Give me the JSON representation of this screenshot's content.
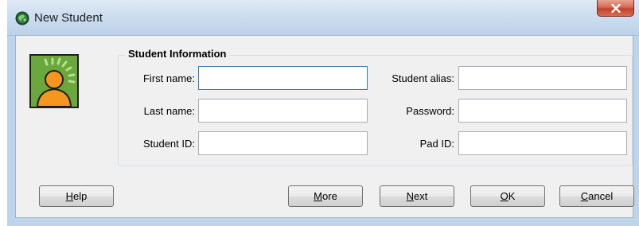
{
  "window": {
    "title": "New Student",
    "icon": "app-globe-icon",
    "close_icon": "close-x-icon"
  },
  "avatar": {
    "icon": "student-avatar-icon"
  },
  "student_info": {
    "group_title": "Student Information",
    "first_name": {
      "label": "First name:",
      "value": ""
    },
    "last_name": {
      "label": "Last name:",
      "value": ""
    },
    "student_id": {
      "label": "Student ID:",
      "value": ""
    },
    "student_alias": {
      "label": "Student alias:",
      "value": ""
    },
    "password": {
      "label": "Password:",
      "value": ""
    },
    "pad_id": {
      "label": "Pad ID:",
      "value": ""
    }
  },
  "buttons": {
    "help": {
      "mnemonic": "H",
      "rest": "elp"
    },
    "more": {
      "mnemonic": "M",
      "rest": "ore"
    },
    "next": {
      "mnemonic": "N",
      "rest": "ext"
    },
    "ok": {
      "mnemonic": "O",
      "rest": "K"
    },
    "cancel": {
      "mnemonic": "C",
      "rest": "ancel"
    }
  },
  "colors": {
    "close_button": "#c1432d",
    "avatar_background": "#6aa83e",
    "avatar_figure": "#f5961e",
    "focus_border": "#3d7bad"
  }
}
